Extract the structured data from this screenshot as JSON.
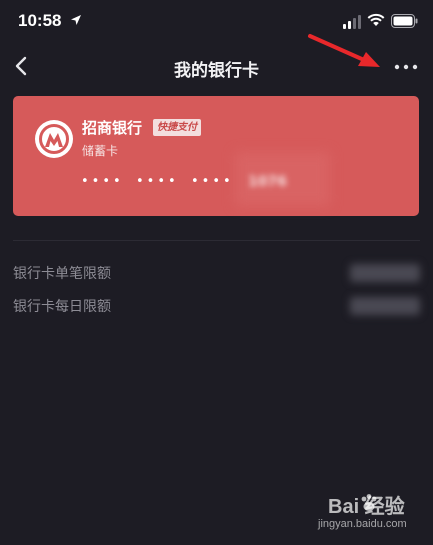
{
  "status_bar": {
    "time": "10:58"
  },
  "nav": {
    "title": "我的银行卡"
  },
  "card": {
    "bank_name": "招商银行",
    "badge": "快捷支付",
    "card_type": "储蓄卡",
    "masks": [
      "••••",
      "••••",
      "••••"
    ],
    "tail_digits_blurred": "1076",
    "color": "#d65a5a"
  },
  "limits": [
    {
      "label": "银行卡单笔限额"
    },
    {
      "label": "银行卡每日限额"
    }
  ],
  "watermark": {
    "brand": "Bai  经验",
    "url": "jingyan.baidu.com"
  },
  "colors": {
    "background": "#1d1c24",
    "card": "#d65a5a",
    "annotation_arrow": "#e8282b"
  },
  "icons": [
    "location-arrow-icon",
    "signal-icon",
    "wifi-icon",
    "battery-icon",
    "back-chevron-icon",
    "more-dots-icon",
    "bank-logo-icon",
    "paw-icon"
  ]
}
